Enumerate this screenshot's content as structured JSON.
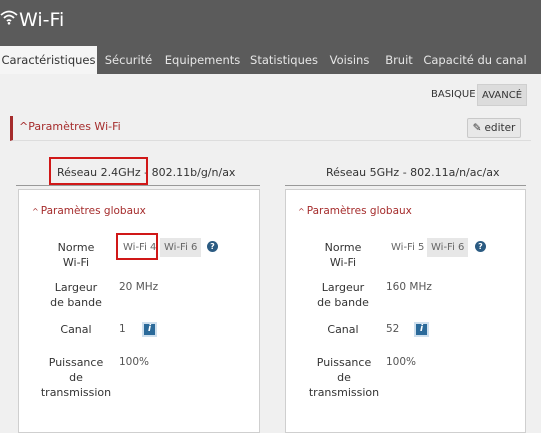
{
  "header": {
    "title": "Wi-Fi",
    "icon": "wifi-icon"
  },
  "tabs": [
    {
      "label": "Caractéristiques",
      "active": true
    },
    {
      "label": "Sécurité"
    },
    {
      "label": "Equipements"
    },
    {
      "label": "Statistiques"
    },
    {
      "label": "Voisins"
    },
    {
      "label": "Bruit"
    },
    {
      "label": "Capacité du canal"
    }
  ],
  "view_toggle": {
    "basique": "BASIQUE",
    "avance": "AVANCÉ",
    "selected": "AVANCÉ"
  },
  "section": {
    "title": "Paramètres Wi-Fi",
    "edit_label": "editer"
  },
  "networks": {
    "left": {
      "name": "Réseau 2.4GHz",
      "standard": " - 802.11b/g/n/ax",
      "panel_title": "Paramètres globaux",
      "norme_label_1": "Norme",
      "norme_label_2": "Wi-Fi",
      "norme_options": [
        "Wi-Fi 4",
        "Wi-Fi 6"
      ],
      "largeur_label_1": "Largeur",
      "largeur_label_2": "de bande",
      "largeur_value": "20 MHz",
      "canal_label": "Canal",
      "canal_value": "1",
      "puissance_label_1": "Puissance",
      "puissance_label_2": "de",
      "puissance_label_3": "transmission",
      "puissance_value": "100%"
    },
    "right": {
      "name": "Réseau 5GHz - 802.11a/n/ac/ax",
      "panel_title": "Paramètres globaux",
      "norme_label_1": "Norme",
      "norme_label_2": "Wi-Fi",
      "norme_options": [
        "Wi-Fi 5",
        "Wi-Fi 6"
      ],
      "largeur_label_1": "Largeur",
      "largeur_label_2": "de bande",
      "largeur_value": "160 MHz",
      "canal_label": "Canal",
      "canal_value": "52",
      "puissance_label_1": "Puissance",
      "puissance_label_2": "de",
      "puissance_label_3": "transmission",
      "puissance_value": "100%"
    }
  },
  "colors": {
    "header_bg": "#5b5b5b",
    "accent_red": "#a52c2c",
    "highlight": "#d01818",
    "info_blue": "#2b6a9a"
  }
}
